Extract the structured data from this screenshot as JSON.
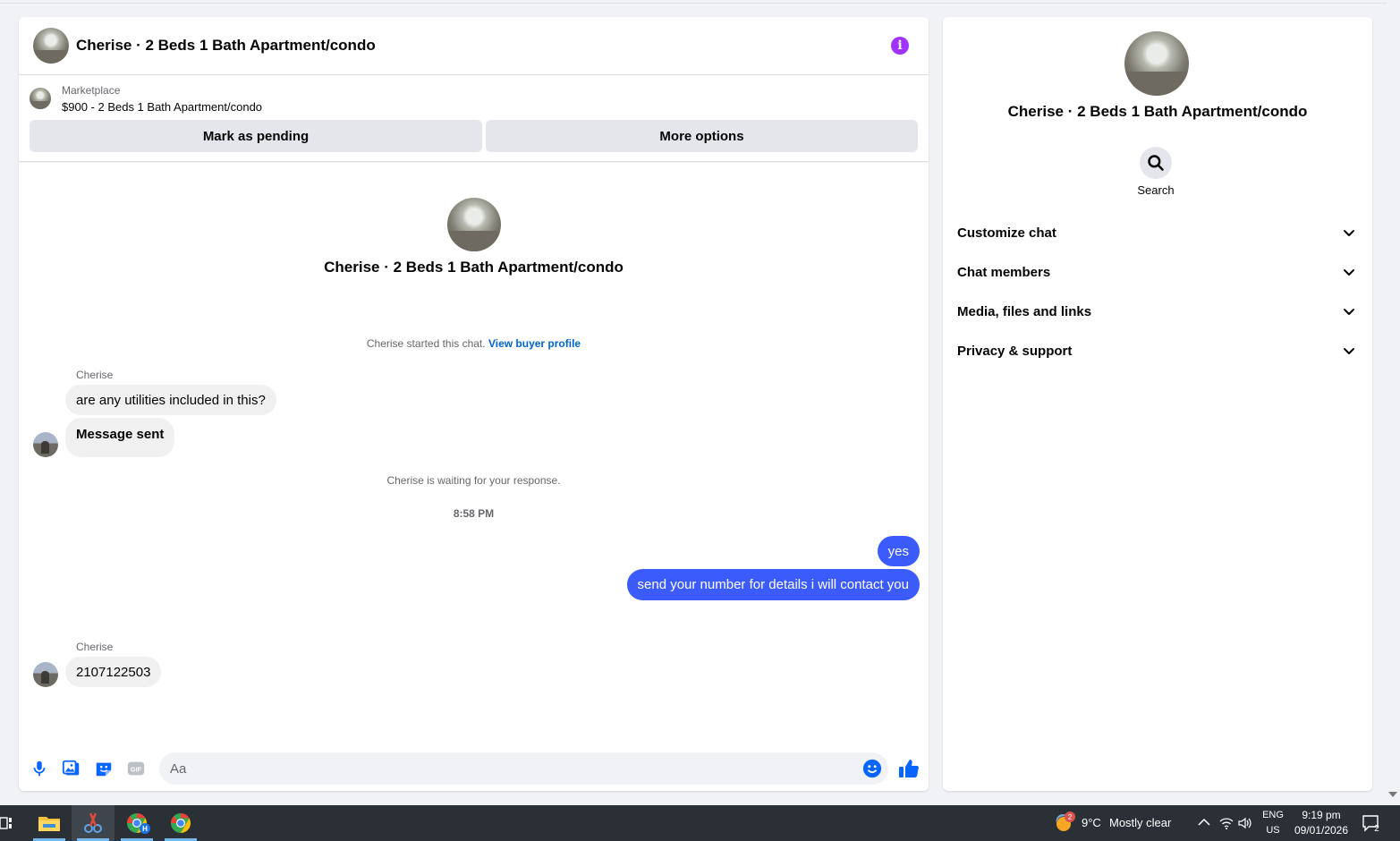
{
  "chat": {
    "title": "Cherise · 2 Beds 1 Bath Apartment/condo",
    "listing": {
      "category": "Marketplace",
      "price_title": "$900 - 2 Beds 1 Bath Apartment/condo"
    },
    "buttons": {
      "mark_pending": "Mark as pending",
      "more_options": "More options"
    },
    "intro_title": "Cherise · 2 Beds 1 Bath Apartment/condo",
    "started_text": "Cherise started this chat.",
    "view_profile": "View buyer profile",
    "messages": [
      {
        "sender": "Cherise",
        "text": "are any utilities included in this?"
      },
      {
        "sender": "",
        "text": "Message sent"
      },
      {
        "system": "Cherise is waiting for your response."
      },
      {
        "time": "8:58 PM"
      },
      {
        "out": "yes"
      },
      {
        "out": "send your number for details i will contact you"
      },
      {
        "sender": "Cherise",
        "text": "2107122503"
      }
    ],
    "composer_placeholder": "Aa"
  },
  "info_panel": {
    "title": "Cherise · 2 Beds 1 Bath Apartment/condo",
    "search_label": "Search",
    "sections": [
      "Customize chat",
      "Chat members",
      "Media, files and links",
      "Privacy & support"
    ]
  },
  "taskbar": {
    "weather_temp": "9°C",
    "weather_desc": "Mostly clear",
    "weather_badge": "2",
    "lang": "ENG",
    "region": "US",
    "time": "9:19 pm",
    "date": "09/01/2026",
    "notification_count": "2",
    "chrome_profile_badge": "H"
  },
  "colors": {
    "accent": "#0866ff",
    "outgoing_bubble": "#3b5bfd",
    "info_icon": "#a033ff",
    "link": "#0064d1"
  }
}
